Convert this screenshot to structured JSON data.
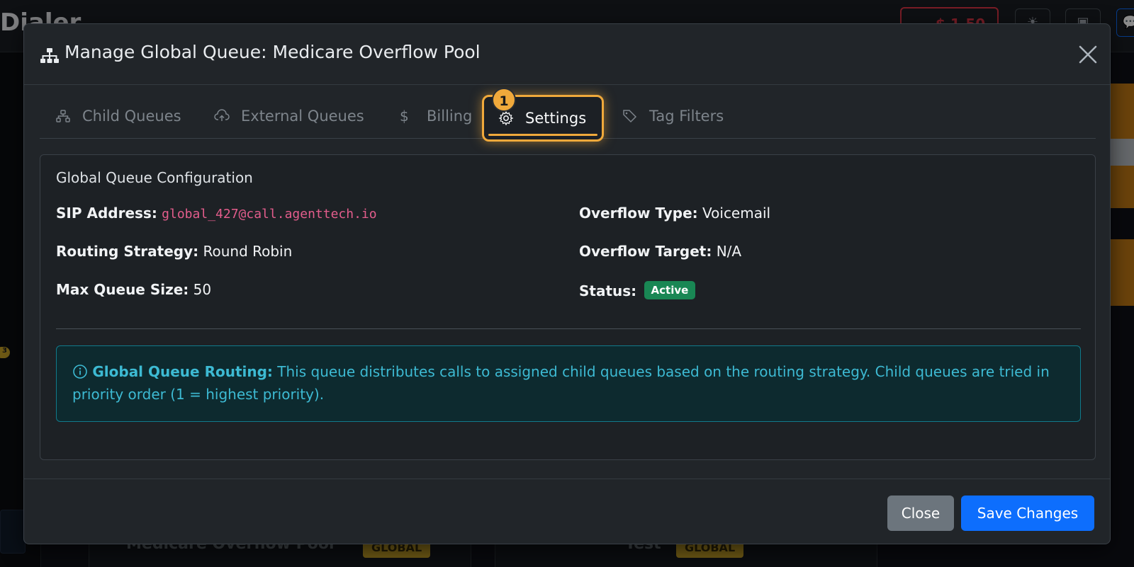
{
  "background": {
    "app_title": "Dialer",
    "balance": "$ 1.50",
    "left_badge": "3",
    "cards": [
      {
        "title": "Medicare Overflow Pool",
        "badge": "GLOBAL"
      },
      {
        "title": "Test",
        "badge": "GLOBAL"
      }
    ]
  },
  "modal": {
    "title": "Manage Global Queue: Medicare Overflow Pool",
    "tabs": [
      {
        "label": "Child Queues",
        "icon": "sitemap-icon"
      },
      {
        "label": "External Queues",
        "icon": "cloud-upload-icon"
      },
      {
        "label": "Billing",
        "icon": "dollar-icon"
      },
      {
        "label": "Settings",
        "icon": "gear-icon",
        "active": true
      },
      {
        "label": "Tag Filters",
        "icon": "tags-icon"
      }
    ],
    "step_badge": "1",
    "config": {
      "title": "Global Queue Configuration",
      "sip_label": "SIP Address:",
      "sip_value": "global_427@call.agenttech.io",
      "routing_label": "Routing Strategy:",
      "routing_value": "Round Robin",
      "max_label": "Max Queue Size:",
      "max_value": "50",
      "overflow_type_label": "Overflow Type:",
      "overflow_type_value": "Voicemail",
      "overflow_target_label": "Overflow Target:",
      "overflow_target_value": "N/A",
      "status_label": "Status:",
      "status_value": "Active"
    },
    "alert": {
      "title": "Global Queue Routing:",
      "text": "This queue distributes calls to assigned child queues based on the routing strategy. Child queues are tried in priority order (1 = highest priority)."
    },
    "footer": {
      "close_label": "Close",
      "save_label": "Save Changes"
    }
  },
  "colors": {
    "accent": "#f0a93b",
    "primary": "#0d6efd",
    "success": "#198754",
    "info": "#3dbad3",
    "danger": "#dc3545"
  }
}
